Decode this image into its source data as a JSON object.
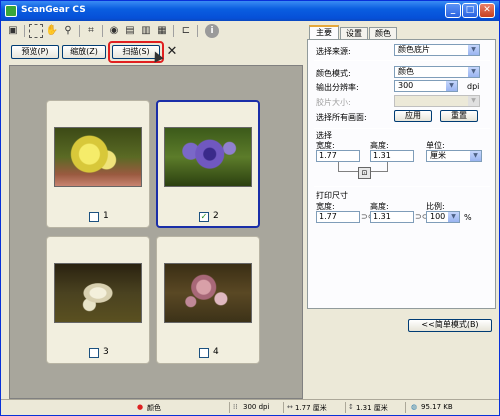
{
  "window": {
    "title": "ScanGear CS",
    "minimize": "_",
    "maximize": "□",
    "close": "✕"
  },
  "toolbar": {
    "icons": [
      "window-icon",
      "select-marquee-icon",
      "hand-icon",
      "zoom-icon",
      "crop-icon",
      "scan-all-icon",
      "thumbnail-icon",
      "page-icon",
      "page2-icon",
      "page3-icon",
      "info-icon"
    ]
  },
  "preview_buttons": {
    "preview": "预览(P)",
    "zoom": "缩放(Z)",
    "scan": "扫描(S)",
    "close": "✕"
  },
  "thumbnails": [
    {
      "number": "1",
      "checked": false
    },
    {
      "number": "2",
      "checked": true
    },
    {
      "number": "3",
      "checked": false
    },
    {
      "number": "4",
      "checked": false
    }
  ],
  "tabs": [
    "主要",
    "设置",
    "颜色"
  ],
  "main": {
    "source_label": "选择来源:",
    "source_value": "颜色底片",
    "color_mode_label": "颜色模式:",
    "color_mode_value": "颜色",
    "resolution_label": "输出分辨率:",
    "resolution_value": "300",
    "resolution_unit": "dpi",
    "film_size_label": "胶片大小:",
    "film_size_value": "",
    "select_all_label": "选择所有画面:",
    "apply": "应用",
    "reset": "重置",
    "selection_header": "选择",
    "width_label": "宽度:",
    "height_label": "高度:",
    "unit_label": "单位:",
    "width_value": "1.77",
    "height_value": "1.31",
    "unit_value": "厘米",
    "print_size_header": "打印尺寸",
    "print_width_label": "宽度:",
    "print_height_label": "高度:",
    "scale_label": "比例:",
    "print_width_value": "1.77",
    "print_height_value": "1.31",
    "scale_value": "100",
    "scale_unit": "%",
    "simple_mode": "<<简单模式(B)"
  },
  "status": {
    "color": "颜色",
    "dpi": "300 dpi",
    "width": "1.77 厘米",
    "height": "1.31 厘米",
    "size": "95.17 KB"
  }
}
